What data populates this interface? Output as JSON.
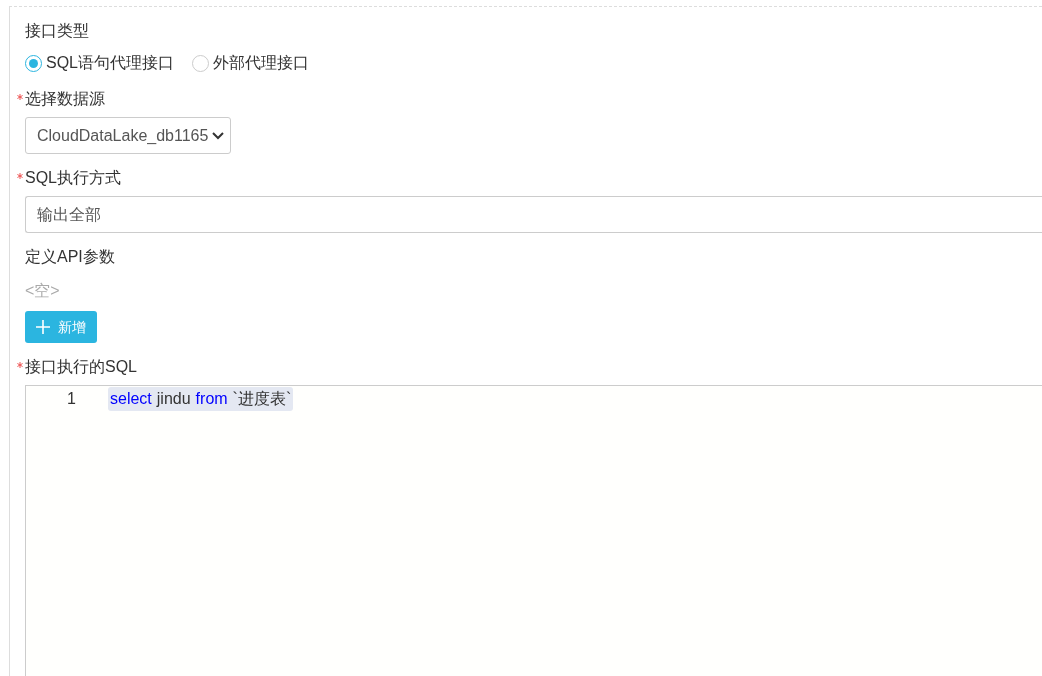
{
  "interface_type": {
    "label": "接口类型",
    "options": [
      {
        "label": "SQL语句代理接口",
        "selected": true
      },
      {
        "label": "外部代理接口",
        "selected": false
      }
    ]
  },
  "datasource": {
    "label": "选择数据源",
    "required": true,
    "value": "CloudDataLake_db1165"
  },
  "exec_mode": {
    "label": "SQL执行方式",
    "required": true,
    "value": "输出全部"
  },
  "api_params": {
    "label": "定义API参数",
    "empty_text": "<空>",
    "add_button": "新增"
  },
  "sql": {
    "label": "接口执行的SQL",
    "required": true,
    "lines": [
      {
        "number": "1",
        "tokens": [
          {
            "kind": "keyword",
            "text": "select"
          },
          {
            "kind": "identifier",
            "text": "jindu"
          },
          {
            "kind": "keyword",
            "text": "from"
          },
          {
            "kind": "identifier",
            "text": "`进度表`"
          }
        ]
      }
    ]
  }
}
